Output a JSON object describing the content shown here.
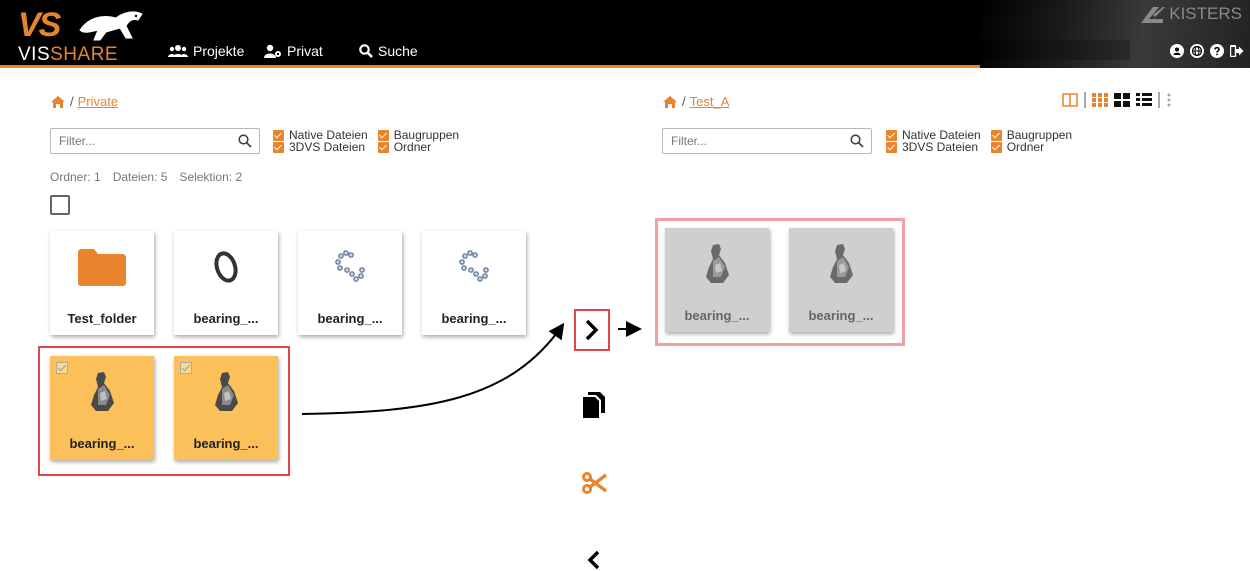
{
  "header": {
    "logo_top": "VS",
    "logo_word_a": "VIS",
    "logo_word_b": "SHARE",
    "brand": "KISTERS",
    "nav": [
      {
        "label": "Projekte",
        "icon": "users-icon"
      },
      {
        "label": "Privat",
        "icon": "user-private-icon"
      },
      {
        "label": "Suche",
        "icon": "search-icon"
      }
    ],
    "tool_icons": [
      "user-icon",
      "globe-icon",
      "help-icon",
      "logout-icon"
    ]
  },
  "left_panel": {
    "breadcrumb_sep": "/",
    "breadcrumb": "Private",
    "filter_placeholder": "Filter...",
    "checkboxes": [
      "Native Dateien",
      "Baugruppen",
      "3DVS Dateien",
      "Ordner"
    ],
    "stats": {
      "folders": "Ordner: 1",
      "files": "Dateien: 5",
      "selection": "Selektion: 2"
    },
    "tiles": [
      {
        "label": "Test_folder",
        "icon": "folder-icon"
      },
      {
        "label": "bearing_...",
        "icon": "ring-icon"
      },
      {
        "label": "bearing_...",
        "icon": "balls-icon"
      },
      {
        "label": "bearing_...",
        "icon": "balls-icon"
      },
      {
        "label": "bearing_...",
        "icon": "part-icon",
        "selected": true
      },
      {
        "label": "bearing_...",
        "icon": "part-icon",
        "selected": true
      }
    ]
  },
  "right_panel": {
    "breadcrumb_sep": "/",
    "breadcrumb": "Test_A",
    "filter_placeholder": "Filter...",
    "checkboxes": [
      "Native Dateien",
      "Baugruppen",
      "3DVS Dateien",
      "Ordner"
    ],
    "tiles": [
      {
        "label": "bearing_...",
        "icon": "part-icon"
      },
      {
        "label": "bearing_...",
        "icon": "part-icon"
      }
    ]
  },
  "actions": [
    "move-right-icon",
    "copy-icon",
    "cut-icon",
    "move-left-icon"
  ],
  "colors": {
    "accent": "#e8842c",
    "selected_tile": "#fcc05a",
    "ghost_tile": "#cfcfcf",
    "highlight": "#e04848"
  }
}
